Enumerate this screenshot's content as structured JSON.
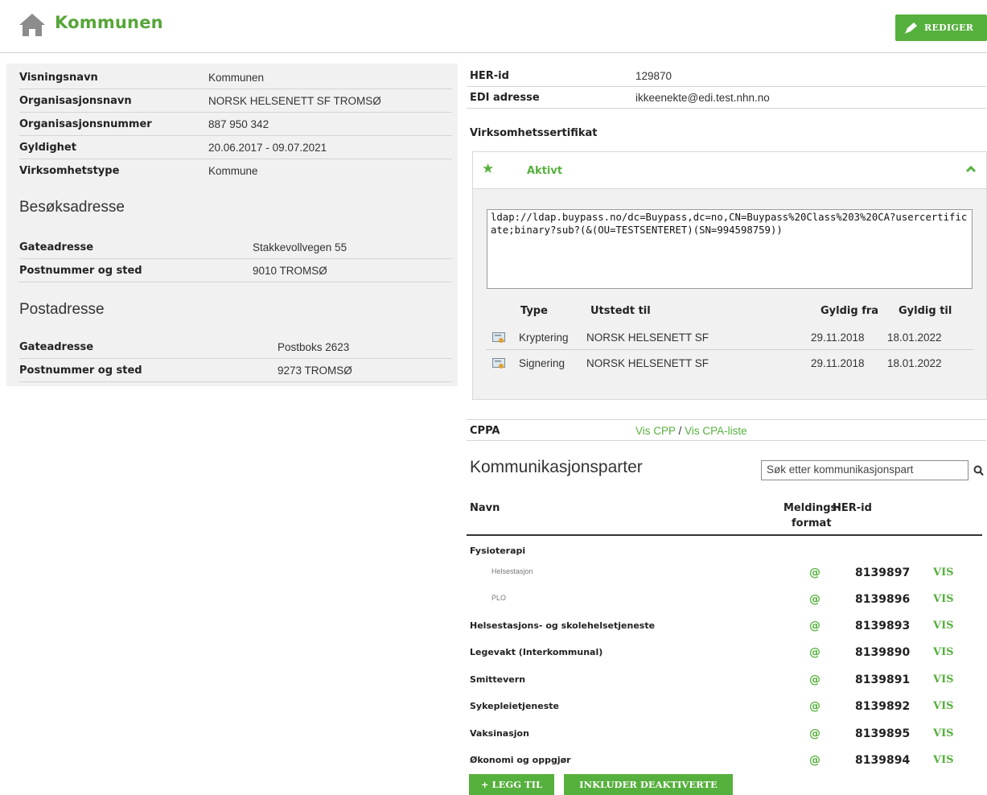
{
  "header": {
    "title": "Kommunen",
    "edit_label": "REDIGER",
    "home_icon": "home-icon",
    "edit_icon": "pencil-icon"
  },
  "colors": {
    "accent": "#56b03d",
    "panel_bg": "#f1f1f1",
    "border": "#d4d4d4"
  },
  "details": [
    {
      "label": "Visningsnavn",
      "value": "Kommunen"
    },
    {
      "label": "Organisasjonsnavn",
      "value": "NORSK HELSENETT SF TROMSØ"
    },
    {
      "label": "Organisasjonsnummer",
      "value": "887 950 342"
    },
    {
      "label": "Gyldighet",
      "value": "20.06.2017 - 09.07.2021"
    },
    {
      "label": "Virksomhetstype",
      "value": "Kommune"
    }
  ],
  "visit_address": {
    "heading": "Besøksadresse",
    "rows": [
      {
        "label": "Gateadresse",
        "value": "Stakkevollvegen 55"
      },
      {
        "label": "Postnummer og sted",
        "value": "9010 TROMSØ"
      }
    ]
  },
  "postal_address": {
    "heading": "Postadresse",
    "rows": [
      {
        "label": "Gateadresse",
        "value": "Postboks 2623"
      },
      {
        "label": "Postnummer og sted",
        "value": "9273 TROMSØ"
      }
    ]
  },
  "ids": [
    {
      "label": "HER-id",
      "value": "129870"
    },
    {
      "label": "EDI adresse",
      "value": "ikkeenekte@edi.test.nhn.no"
    }
  ],
  "certificate": {
    "heading": "Virksomhetssertifikat",
    "status_label": "Aktivt",
    "ldap": "ldap://ldap.buypass.no/dc=Buypass,dc=no,CN=Buypass%20Class%203%20CA?usercertificate;binary?sub?(&(OU=TESTSENTERET)(SN=994598759))",
    "columns": [
      "Type",
      "Utstedt til",
      "Gyldig fra",
      "Gyldig til"
    ],
    "rows": [
      {
        "type": "Kryptering",
        "issued_to": "NORSK HELSENETT SF",
        "valid_from": "29.11.2018",
        "valid_to": "18.01.2022"
      },
      {
        "type": "Signering",
        "issued_to": "NORSK HELSENETT SF",
        "valid_from": "29.11.2018",
        "valid_to": "18.01.2022"
      }
    ]
  },
  "cppa": {
    "label": "CPPA",
    "link_cpp": "Vis CPP",
    "separator": "/",
    "link_cpa": "Vis CPA-liste"
  },
  "partners": {
    "title": "Kommunikasjonsparter",
    "search_placeholder": "Søk etter kommunikasjonspart",
    "col_name": "Navn",
    "col_format_1": "Meldings-",
    "col_format_2": "format",
    "col_her": "HER-id",
    "group_label": "Fysioterapi",
    "rows": [
      {
        "name": "Helsestasjon",
        "format": "@",
        "her": "8139897",
        "action": "VIS"
      },
      {
        "name": "PLO",
        "format": "@",
        "her": "8139896",
        "action": "VIS"
      },
      {
        "name": "Helsestasjons- og skolehelsetjeneste",
        "format": "@",
        "her": "8139893",
        "action": "VIS"
      },
      {
        "name": "Legevakt (Interkommunal)",
        "format": "@",
        "her": "8139890",
        "action": "VIS"
      },
      {
        "name": "Smittevern",
        "format": "@",
        "her": "8139891",
        "action": "VIS"
      },
      {
        "name": "Sykepleietjeneste",
        "format": "@",
        "her": "8139892",
        "action": "VIS"
      },
      {
        "name": "Vaksinasjon",
        "format": "@",
        "her": "8139895",
        "action": "VIS"
      },
      {
        "name": "Økonomi og oppgjør",
        "format": "@",
        "her": "8139894",
        "action": "VIS"
      }
    ],
    "add_label": "+ LEGG TIL",
    "include_label": "INKLUDER DEAKTIVERTE"
  }
}
